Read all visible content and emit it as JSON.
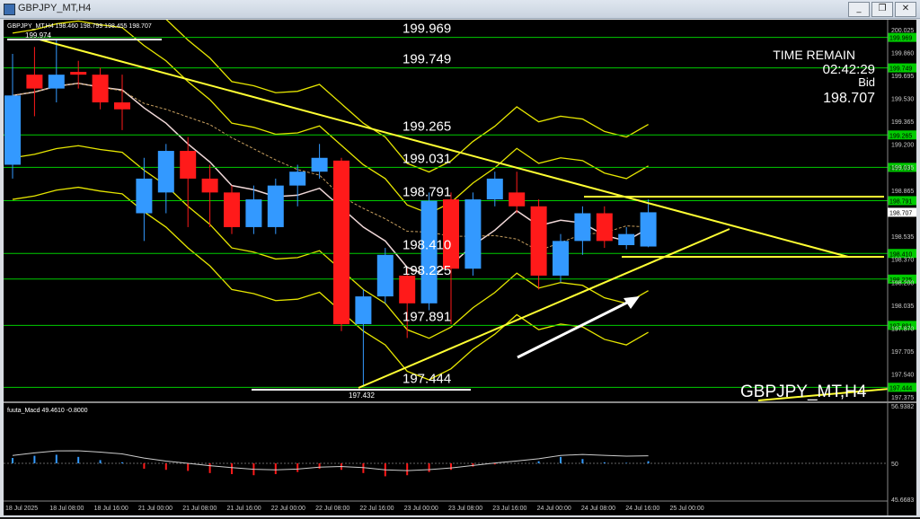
{
  "window": {
    "title": "GBPJPY_MT,H4",
    "buttons": {
      "minimize": "_",
      "restore": "❐",
      "close": "✕"
    }
  },
  "header": {
    "info": "GBPJPY_MT,H4  198.460 198.799 198.455 198.707",
    "high_marker": "199.974"
  },
  "countdown": {
    "label": "TIME REMAIN",
    "time": "02:42:29",
    "bid_label": "Bid",
    "bid": "198.707"
  },
  "symbol_label": "GBPJPY_MT,H4",
  "levels": [
    {
      "value": 199.969,
      "label": "199.969"
    },
    {
      "value": 199.749,
      "label": "199.749"
    },
    {
      "value": 199.265,
      "label": "199.265"
    },
    {
      "value": 199.031,
      "label": "199.031"
    },
    {
      "value": 198.791,
      "label": "198.791"
    },
    {
      "value": 198.41,
      "label": "198.410"
    },
    {
      "value": 198.225,
      "label": "198.225"
    },
    {
      "value": 197.891,
      "label": "197.891"
    },
    {
      "value": 197.444,
      "label": "197.444"
    }
  ],
  "low_marker": "197.432",
  "price_axis": [
    "200.025",
    "199.860",
    "199.695",
    "199.530",
    "199.365",
    "199.200",
    "199.035",
    "198.865",
    "198.700",
    "198.535",
    "198.370",
    "198.200",
    "198.035",
    "197.870",
    "197.705",
    "197.540",
    "197.375"
  ],
  "current_price": "198.707",
  "time_axis": [
    "18 Jul 2025",
    "18 Jul 08:00",
    "18 Jul 16:00",
    "21 Jul 00:00",
    "21 Jul 08:00",
    "21 Jul 16:00",
    "22 Jul 00:00",
    "22 Jul 08:00",
    "22 Jul 16:00",
    "23 Jul 00:00",
    "23 Jul 08:00",
    "23 Jul 16:00",
    "24 Jul 00:00",
    "24 Jul 08:00",
    "24 Jul 16:00",
    "25 Jul 00:00"
  ],
  "macd": {
    "label": "fuuta_Macd 49.4610 -0.8000",
    "axis": [
      "56.9382",
      "50",
      "45.6683"
    ]
  },
  "colors": {
    "bull": "#3399ff",
    "bear": "#ff1a1a",
    "level": "#00cc00",
    "band": "#e6e600",
    "trend": "#ffff33"
  },
  "chart_data": {
    "type": "candlestick",
    "title": "GBPJPY_MT,H4",
    "y_range": [
      197.375,
      200.025
    ],
    "candles": [
      {
        "o": 199.05,
        "h": 199.85,
        "l": 198.95,
        "c": 199.55
      },
      {
        "o": 199.7,
        "h": 199.9,
        "l": 199.4,
        "c": 199.6
      },
      {
        "o": 199.6,
        "h": 199.95,
        "l": 199.5,
        "c": 199.7
      },
      {
        "o": 199.72,
        "h": 199.8,
        "l": 199.6,
        "c": 199.7
      },
      {
        "o": 199.7,
        "h": 199.75,
        "l": 199.45,
        "c": 199.5
      },
      {
        "o": 199.5,
        "h": 199.7,
        "l": 199.3,
        "c": 199.45
      },
      {
        "o": 198.7,
        "h": 199.1,
        "l": 198.5,
        "c": 198.95
      },
      {
        "o": 198.85,
        "h": 199.2,
        "l": 198.7,
        "c": 199.15
      },
      {
        "o": 199.15,
        "h": 199.25,
        "l": 198.6,
        "c": 198.95
      },
      {
        "o": 198.95,
        "h": 199.05,
        "l": 198.6,
        "c": 198.85
      },
      {
        "o": 198.85,
        "h": 198.9,
        "l": 198.55,
        "c": 198.6
      },
      {
        "o": 198.6,
        "h": 198.9,
        "l": 198.55,
        "c": 198.8
      },
      {
        "o": 198.6,
        "h": 198.95,
        "l": 198.55,
        "c": 198.9
      },
      {
        "o": 198.9,
        "h": 199.05,
        "l": 198.75,
        "c": 199.0
      },
      {
        "o": 199.0,
        "h": 199.2,
        "l": 198.95,
        "c": 199.1
      },
      {
        "o": 199.08,
        "h": 199.1,
        "l": 197.85,
        "c": 197.9
      },
      {
        "o": 197.9,
        "h": 198.15,
        "l": 197.45,
        "c": 198.1
      },
      {
        "o": 198.1,
        "h": 198.45,
        "l": 198.05,
        "c": 198.4
      },
      {
        "o": 198.25,
        "h": 198.3,
        "l": 197.8,
        "c": 198.05
      },
      {
        "o": 198.05,
        "h": 198.85,
        "l": 198.0,
        "c": 198.79
      },
      {
        "o": 198.8,
        "h": 198.85,
        "l": 197.9,
        "c": 198.3
      },
      {
        "o": 198.3,
        "h": 198.85,
        "l": 198.25,
        "c": 198.8
      },
      {
        "o": 198.8,
        "h": 199.0,
        "l": 198.75,
        "c": 198.95
      },
      {
        "o": 198.85,
        "h": 199.0,
        "l": 198.7,
        "c": 198.75
      },
      {
        "o": 198.75,
        "h": 198.8,
        "l": 198.15,
        "c": 198.25
      },
      {
        "o": 198.25,
        "h": 198.55,
        "l": 198.2,
        "c": 198.5
      },
      {
        "o": 198.5,
        "h": 198.75,
        "l": 198.4,
        "c": 198.7
      },
      {
        "o": 198.7,
        "h": 198.75,
        "l": 198.45,
        "c": 198.5
      },
      {
        "o": 198.47,
        "h": 198.6,
        "l": 198.44,
        "c": 198.55
      },
      {
        "o": 198.46,
        "h": 198.8,
        "l": 198.455,
        "c": 198.707
      }
    ],
    "macd_hist": [
      0.5,
      0.7,
      0.8,
      0.6,
      0.3,
      0.1,
      -0.5,
      -0.6,
      -0.7,
      -0.9,
      -1.0,
      -1.1,
      -1.0,
      -0.8,
      -0.5,
      -0.6,
      -0.9,
      -1.2,
      -1.1,
      -0.8,
      -0.6,
      -0.3,
      -0.1,
      0.0,
      0.2,
      0.6,
      0.4,
      0.1,
      0.05,
      0.2
    ]
  }
}
